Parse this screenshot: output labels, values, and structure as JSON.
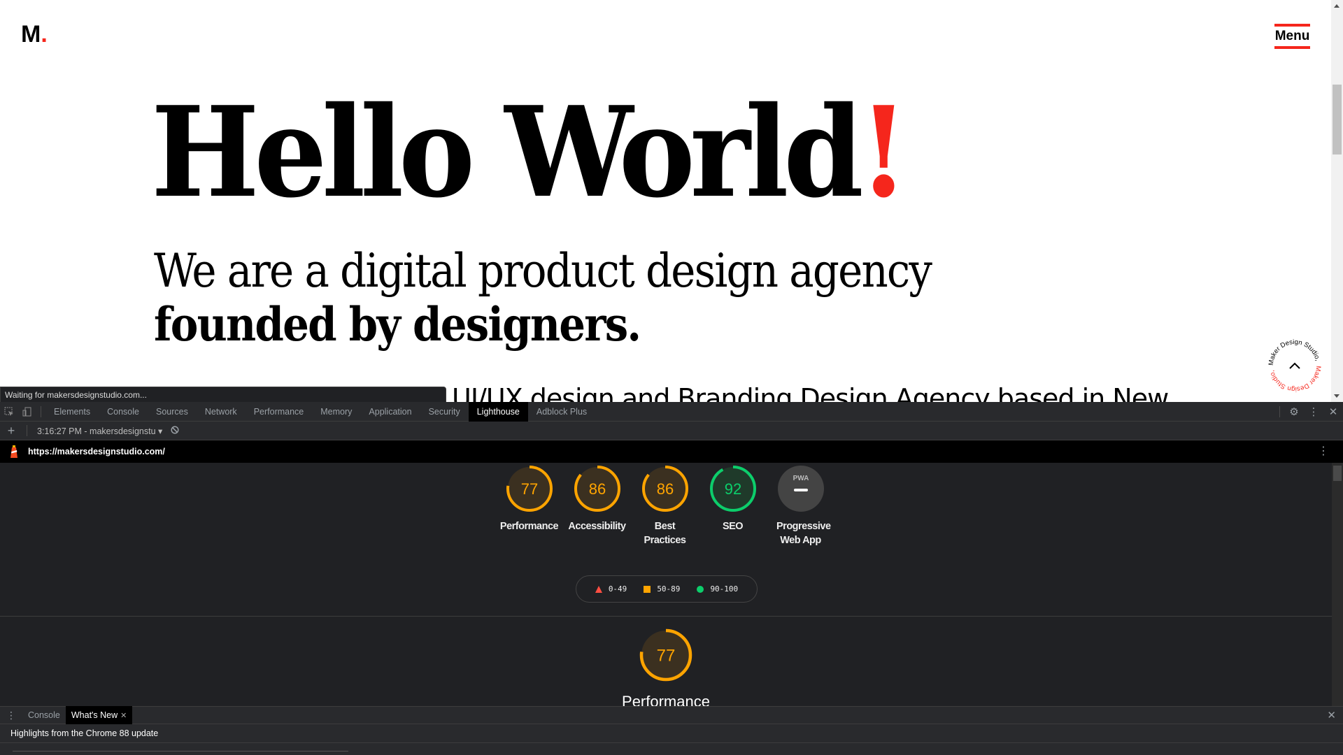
{
  "page": {
    "logo": {
      "letter": "M",
      "dot": "."
    },
    "menu_label": "Menu",
    "hero": {
      "title": "Hello World",
      "title_accent": "!",
      "subtitle_line1": "We are a digital product design agency",
      "subtitle_line2": "founded by designers.",
      "tagline": "UI/UX design and Branding Design Agency based in New"
    },
    "circular_badge": {
      "text_dark": "Maker Design Studio,",
      "text_red": " Maker Design Studio,",
      "icon": "chevron-up-icon"
    },
    "status_bubble": "Waiting for makersdesignstudio.com..."
  },
  "colors": {
    "brand_red": "#f5261c",
    "average": "#ffa400",
    "pass": "#0cce6b",
    "fail": "#ff4e42"
  },
  "devtools": {
    "tabs": [
      {
        "label": "Elements",
        "active": false
      },
      {
        "label": "Console",
        "active": false
      },
      {
        "label": "Sources",
        "active": false
      },
      {
        "label": "Network",
        "active": false
      },
      {
        "label": "Performance",
        "active": false
      },
      {
        "label": "Memory",
        "active": false
      },
      {
        "label": "Application",
        "active": false
      },
      {
        "label": "Security",
        "active": false
      },
      {
        "label": "Lighthouse",
        "active": true
      },
      {
        "label": "Adblock Plus",
        "active": false
      }
    ],
    "toolbar": {
      "report_select": "3:16:27 PM - makersdesignstu",
      "add_icon": "plus-icon",
      "clear_icon": "block-icon"
    },
    "lighthouse": {
      "url": "https://makersdesignstudio.com/",
      "scores": [
        {
          "label": "Performance",
          "score": 77,
          "status": "average"
        },
        {
          "label": "Accessibility",
          "score": 86,
          "status": "average"
        },
        {
          "label": "Best Practices",
          "score": 86,
          "status": "average"
        },
        {
          "label": "SEO",
          "score": 92,
          "status": "pass"
        },
        {
          "label": "Progressive Web App",
          "score": null,
          "badge": "PWA",
          "status": "na"
        }
      ],
      "legend": [
        {
          "range": "0-49",
          "shape": "triangle"
        },
        {
          "range": "50-89",
          "shape": "square"
        },
        {
          "range": "90-100",
          "shape": "circle"
        }
      ],
      "section": {
        "title": "Performance",
        "score": 77
      }
    },
    "drawer": {
      "tabs": [
        {
          "label": "Console",
          "active": false
        },
        {
          "label": "What's New",
          "active": true,
          "closable": true
        }
      ],
      "headline": "Highlights from the Chrome 88 update"
    }
  }
}
